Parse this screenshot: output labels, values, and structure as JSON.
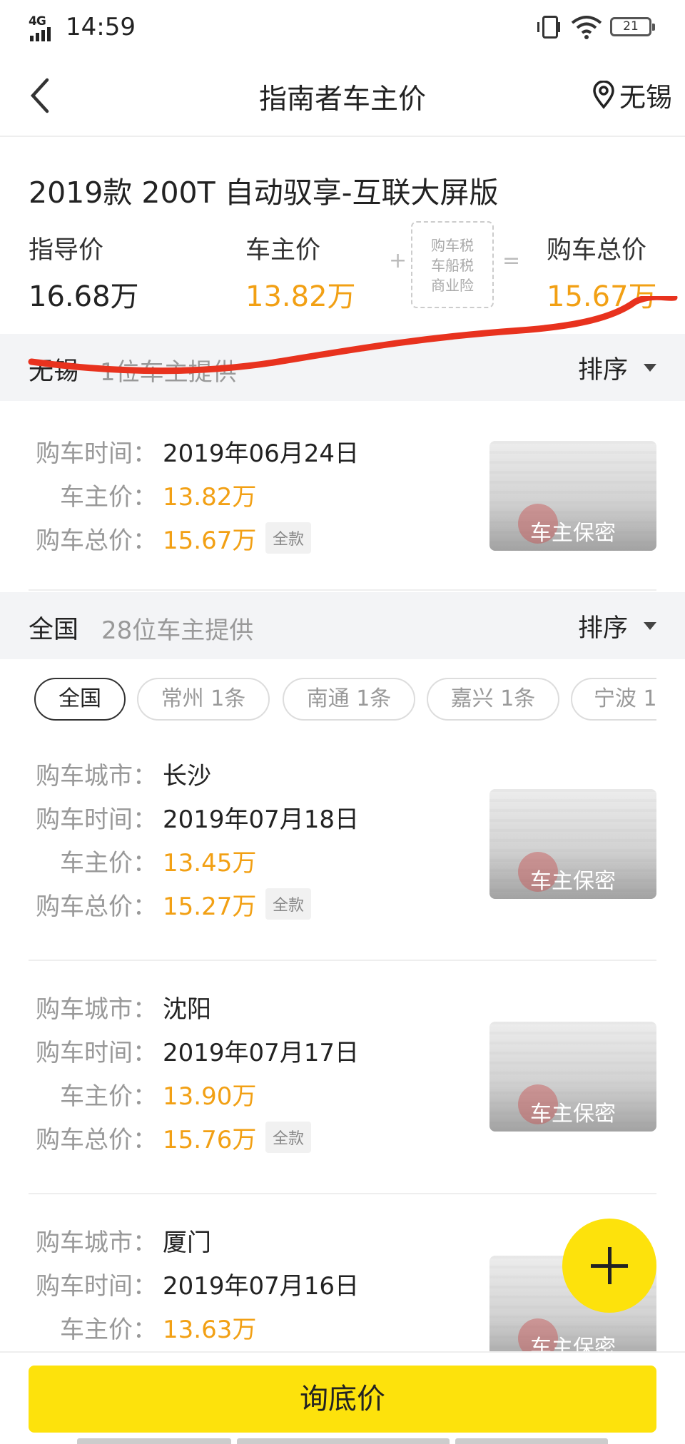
{
  "status_bar": {
    "network": "4G",
    "time": "14:59",
    "battery": "21"
  },
  "header": {
    "title": "指南者车主价",
    "location": "无锡"
  },
  "summary": {
    "model": "2019款 200T 自动驭享-互联大屏版",
    "guide_label": "指导价",
    "guide_value": "16.68万",
    "owner_label": "车主价",
    "owner_value": "13.82万",
    "plus": "+",
    "taxes": [
      "购车税",
      "车船税",
      "商业险"
    ],
    "equals": "=",
    "total_label": "购车总价",
    "total_value": "15.67万"
  },
  "local_section": {
    "city": "无锡",
    "count": "1位车主提供",
    "sort_label": "排序"
  },
  "national_section": {
    "city": "全国",
    "count": "28位车主提供",
    "sort_label": "排序"
  },
  "labels": {
    "city": "购车城市：",
    "time": "购车时间：",
    "owner_price": "车主价：",
    "total": "购车总价：",
    "full_payment": "全款",
    "thumb_caption": "车主保密"
  },
  "local_record": {
    "time": "2019年06月24日",
    "owner_price": "13.82万",
    "total": "15.67万"
  },
  "chips": [
    "全国",
    "常州 1条",
    "南通 1条",
    "嘉兴 1条",
    "宁波 1"
  ],
  "records": [
    {
      "city": "长沙",
      "time": "2019年07月18日",
      "owner_price": "13.45万",
      "total": "15.27万"
    },
    {
      "city": "沈阳",
      "time": "2019年07月17日",
      "owner_price": "13.90万",
      "total": "15.76万"
    },
    {
      "city": "厦门",
      "time": "2019年07月16日",
      "owner_price": "13.63万"
    }
  ],
  "cta": "询底价",
  "colors": {
    "accent_yellow": "#fde20c",
    "price_orange": "#f2a014",
    "annotation_red": "#e8321e"
  }
}
